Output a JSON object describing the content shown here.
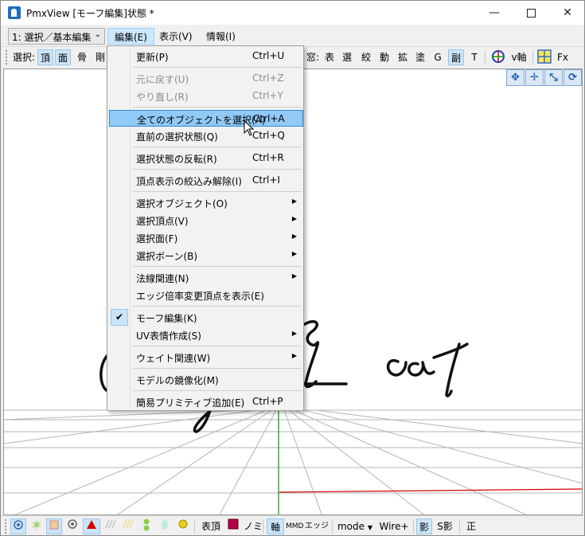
{
  "window": {
    "title": "PmxView [モーフ編集]状態 *",
    "minimize_glyph": "—",
    "close_glyph": "✕"
  },
  "menubar": {
    "mode_select_value": "1: 選択／基本編集",
    "items": [
      {
        "label": "編集(E)",
        "active": true
      },
      {
        "label": "表示(V)",
        "active": false
      },
      {
        "label": "情報(I)",
        "active": false
      }
    ]
  },
  "toolbar": {
    "select_label": "選択:",
    "sel_buttons": [
      "頂",
      "面",
      "骨",
      "剛"
    ],
    "window_label": "窓:",
    "win_buttons": [
      "表",
      "選",
      "絞",
      "動",
      "拡",
      "塗",
      "G",
      "副",
      "T"
    ],
    "axis_label": "v軸",
    "fx_label": "Fx"
  },
  "edit_menu": [
    {
      "label": "更新(P)",
      "shortcut": "Ctrl+U",
      "state": "normal"
    },
    {
      "sep": true
    },
    {
      "label": "元に戻す(U)",
      "shortcut": "Ctrl+Z",
      "state": "disabled"
    },
    {
      "label": "やり直し(R)",
      "shortcut": "Ctrl+Y",
      "state": "disabled"
    },
    {
      "sep": true
    },
    {
      "label": "全てのオブジェクトを選択(A)",
      "shortcut": "Ctrl+A",
      "state": "highlighted"
    },
    {
      "label": "直前の選択状態(Q)",
      "shortcut": "Ctrl+Q",
      "state": "normal"
    },
    {
      "sep": true
    },
    {
      "label": "選択状態の反転(R)",
      "shortcut": "Ctrl+R",
      "state": "normal"
    },
    {
      "sep": true
    },
    {
      "label": "頂点表示の絞込み解除(I)",
      "shortcut": "Ctrl+I",
      "state": "normal"
    },
    {
      "sep": true
    },
    {
      "label": "選択オブジェクト(O)",
      "submenu": true,
      "state": "normal"
    },
    {
      "label": "選択頂点(V)",
      "submenu": true,
      "state": "normal"
    },
    {
      "label": "選択面(F)",
      "submenu": true,
      "state": "normal"
    },
    {
      "label": "選択ボーン(B)",
      "submenu": true,
      "state": "normal"
    },
    {
      "sep": true
    },
    {
      "label": "法線関連(N)",
      "submenu": true,
      "state": "normal"
    },
    {
      "label": "エッジ倍率変更頂点を表示(E)",
      "state": "normal"
    },
    {
      "sep": true
    },
    {
      "label": "モーフ編集(K)",
      "checked": true,
      "state": "normal"
    },
    {
      "label": "UV表情作成(S)",
      "submenu": true,
      "state": "normal"
    },
    {
      "sep": true
    },
    {
      "label": "ウェイト関連(W)",
      "submenu": true,
      "state": "normal"
    },
    {
      "sep": true
    },
    {
      "label": "モデルの鏡像化(M)",
      "state": "normal"
    },
    {
      "sep": true
    },
    {
      "label": "簡易プリミティブ追加(E)",
      "shortcut": "Ctrl+P",
      "state": "normal"
    }
  ],
  "statusbar": {
    "vertex_label": "表頂",
    "nomi_label": "ノミ",
    "axis_label": "軸",
    "mmd_label": "MMD",
    "edge_label": "エッジ",
    "mode_label": "mode",
    "wire_label": "Wire+",
    "shadow_label": "影",
    "sshadow_label": "S影",
    "front_label": "正"
  },
  "colors": {
    "highlight": "#91c9f7",
    "grid_x_axis": "#d40000",
    "grid_z_axis": "#00a000"
  }
}
